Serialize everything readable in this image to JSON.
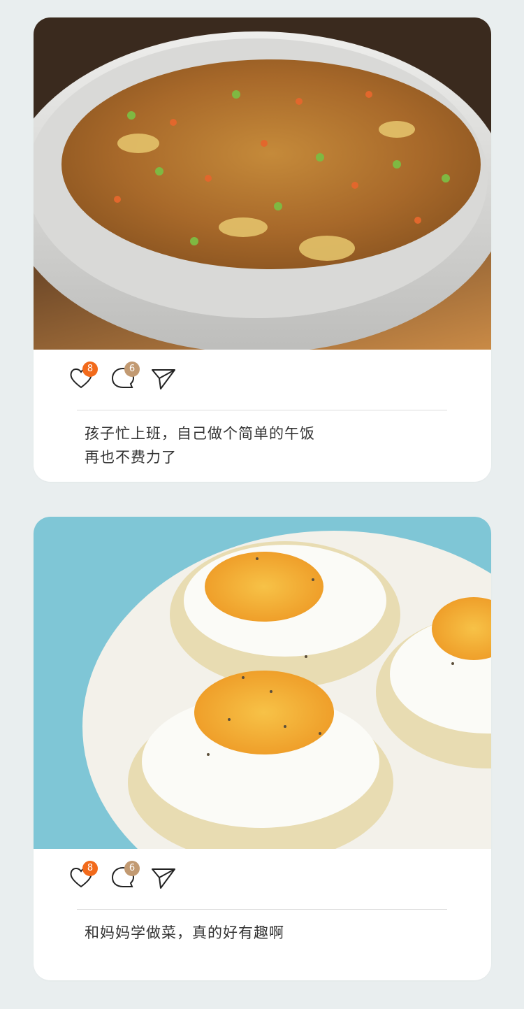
{
  "posts": [
    {
      "id_label": "post-1",
      "image_subject": "fried-rice-photo",
      "likes": "8",
      "comments": "6",
      "caption_lines": [
        "孩子忙上班，自己做个简单的午饭",
        "再也不费力了"
      ]
    },
    {
      "id_label": "post-2",
      "image_subject": "fried-egg-photo",
      "likes": "8",
      "comments": "6",
      "caption_lines": [
        "和妈妈学做菜，真的好有趣啊"
      ]
    }
  ],
  "icons": {
    "like": "heart-icon",
    "comment": "comment-bubble-icon",
    "share": "paper-plane-icon"
  },
  "colors": {
    "background": "#e9eeef",
    "card": "#ffffff",
    "like_badge": "#f26a1b",
    "comment_badge": "#c29a72",
    "text": "#333333"
  }
}
